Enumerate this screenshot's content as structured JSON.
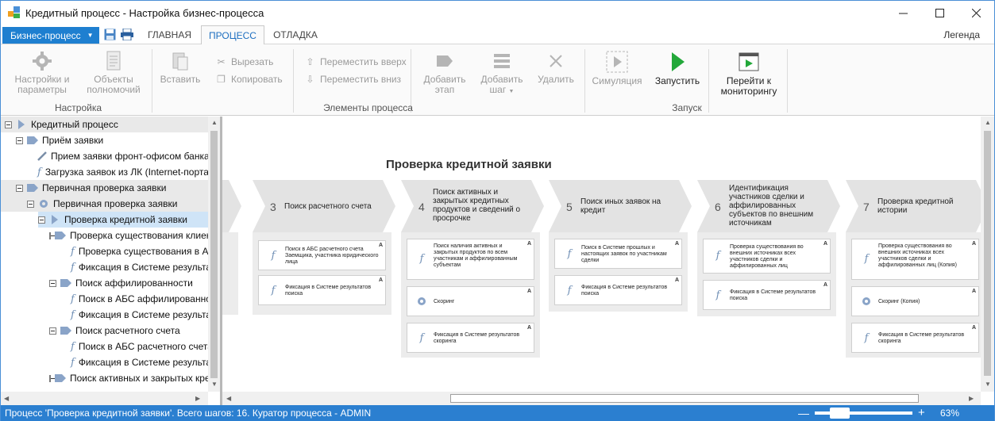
{
  "window": {
    "title": "Кредитный процесс - Настройка бизнес-процесса"
  },
  "menu": {
    "app_button": "Бизнес-процесс",
    "tabs": [
      {
        "label": "ГЛАВНАЯ"
      },
      {
        "label": "ПРОЦЕСС"
      },
      {
        "label": "ОТЛАДКА"
      }
    ],
    "active_tab": "ПРОЦЕСС",
    "legend": "Легенда"
  },
  "ribbon": {
    "settings": {
      "label1": "Настройки и",
      "label2": "параметры"
    },
    "objects": {
      "label1": "Объекты",
      "label2": "полномочий"
    },
    "group_setup": "Настройка",
    "paste": "Вставить",
    "cut": "Вырезать",
    "copy": "Копировать",
    "move_up": "Переместить вверх",
    "move_down": "Переместить вниз",
    "add_stage": {
      "label1": "Добавить",
      "label2": "этап"
    },
    "add_step": {
      "label1": "Добавить",
      "label2": "шаг"
    },
    "delete": "Удалить",
    "group_elements": "Элементы процесса",
    "simulation": "Симуляция",
    "run": "Запустить",
    "monitor": {
      "label1": "Перейти к",
      "label2": "мониторингу"
    },
    "group_launch": "Запуск",
    "accent_green": "#23a83a"
  },
  "tree": {
    "items": [
      {
        "label": "Кредитный процесс"
      },
      {
        "label": "Приём заявки"
      },
      {
        "label": "Прием заявки фронт-офисом банка"
      },
      {
        "label": "Загрузка заявок из ЛК (Internet-портал)"
      },
      {
        "label": "Первичная проверка заявки"
      },
      {
        "label": "Первичная проверка заявки"
      },
      {
        "label": "Проверка кредитной заявки"
      },
      {
        "label": "Проверка существования клиента"
      },
      {
        "label": "Проверка существования в АБС"
      },
      {
        "label": "Фиксация в Системе результата"
      },
      {
        "label": "Поиск аффилированности"
      },
      {
        "label": "Поиск в АБС аффилированности"
      },
      {
        "label": "Фиксация в Системе результата"
      },
      {
        "label": "Поиск расчетного счета"
      },
      {
        "label": "Поиск в АБС расчетного счета"
      },
      {
        "label": "Фиксация в Системе результата"
      },
      {
        "label": "Поиск активных и закрытых кредитов"
      }
    ]
  },
  "canvas": {
    "title": "Проверка кредитной заявки",
    "stages": [
      {
        "num": "3",
        "name": "Поиск расчетного счета",
        "cards": [
          {
            "icon": "fx",
            "text": "Поиск в АБС расчетного счета Заемщика, участника юридического лица",
            "badge": "A"
          },
          {
            "icon": "fx",
            "text": "Фиксация в Системе результатов поиска",
            "badge": "A"
          }
        ]
      },
      {
        "num": "4",
        "name": "Поиск активных и закрытых кредитных продуктов и сведений о просрочке",
        "cards": [
          {
            "icon": "fx",
            "text": "Поиск наличия активных и закрытых продуктов по всем участникам и аффилированным субъектам",
            "badge": "A"
          },
          {
            "icon": "gear",
            "text": "Скоринг",
            "badge": "A"
          },
          {
            "icon": "fx",
            "text": "Фиксация в Системе результатов скоринга",
            "badge": "A"
          }
        ]
      },
      {
        "num": "5",
        "name": "Поиск иных заявок на кредит",
        "cards": [
          {
            "icon": "fx",
            "text": "Поиск в Системе прошлых и настоящих заявок по участникам сделки",
            "badge": "A"
          },
          {
            "icon": "fx",
            "text": "Фиксация в Системе результатов поиска",
            "badge": "A"
          }
        ]
      },
      {
        "num": "6",
        "name": "Идентификация участников сделки и аффилированных субъектов по внешним источникам",
        "cards": [
          {
            "icon": "fx",
            "text": "Проверка существования во внешних источниках всех участников сделки и аффилированных лиц",
            "badge": "A"
          },
          {
            "icon": "fx",
            "text": "Фиксация в Системе результатов поиска",
            "badge": "A"
          }
        ]
      },
      {
        "num": "7",
        "name": "Проверка кредитной истории",
        "cards": [
          {
            "icon": "fx",
            "text": "Проверка существования во внешних источниках всех участников сделки и аффилированных лиц (Копия)",
            "badge": "A"
          },
          {
            "icon": "gear",
            "text": "Скоринг (Копия)",
            "badge": "A"
          },
          {
            "icon": "fx",
            "text": "Фиксация в Системе результатов скоринга",
            "badge": "A"
          }
        ]
      }
    ]
  },
  "status": {
    "text": "Процесс 'Проверка кредитной заявки'. Всего шагов: 16. Куратор процесса - ADMIN",
    "zoom": "63%",
    "zoom_minus": "—",
    "zoom_plus": "+"
  }
}
